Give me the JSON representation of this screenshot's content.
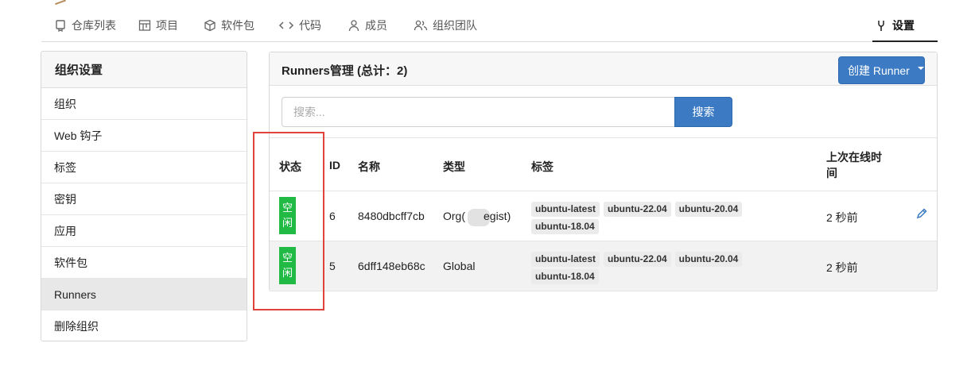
{
  "nav": {
    "items": [
      {
        "label": "仓库列表",
        "icon": "repo-list-icon"
      },
      {
        "label": "项目",
        "icon": "project-icon"
      },
      {
        "label": "软件包",
        "icon": "package-icon"
      },
      {
        "label": "代码",
        "icon": "code-icon"
      },
      {
        "label": "成员",
        "icon": "member-icon"
      },
      {
        "label": "组织团队",
        "icon": "team-icon"
      }
    ],
    "settings": {
      "label": "设置",
      "icon": "tool-icon"
    }
  },
  "sidebar": {
    "title": "组织设置",
    "items": [
      {
        "label": "组织"
      },
      {
        "label": "Web 钩子"
      },
      {
        "label": "标签"
      },
      {
        "label": "密钥"
      },
      {
        "label": "应用"
      },
      {
        "label": "软件包"
      },
      {
        "label": "Runners"
      },
      {
        "label": "删除组织"
      }
    ],
    "active": "Runners"
  },
  "panel": {
    "title": "Runners管理 (总计：2)",
    "create_button": "创建 Runner",
    "search": {
      "placeholder": "搜索...",
      "value": "",
      "button": "搜索"
    }
  },
  "table": {
    "headers": {
      "status": "状态",
      "id": "ID",
      "name": "名称",
      "type": "类型",
      "labels": "标签",
      "last_online": "上次在线时间"
    },
    "rows": [
      {
        "status": "空闲",
        "id": "6",
        "name": "8480dbcff7cb",
        "type": "Org(",
        "type_suffix": "egist)",
        "labels": [
          "ubuntu-latest",
          "ubuntu-22.04",
          "ubuntu-20.04",
          "ubuntu-18.04"
        ],
        "last_online": "2 秒前"
      },
      {
        "status": "空闲",
        "id": "5",
        "name": "6dff148eb68c",
        "type": "Global",
        "type_suffix": "",
        "labels": [
          "ubuntu-latest",
          "ubuntu-22.04",
          "ubuntu-20.04",
          "ubuntu-18.04"
        ],
        "last_online": "2 秒前"
      }
    ]
  },
  "colors": {
    "primary": "#3c7bc4",
    "status_idle": "#21ba45",
    "highlight_box": "#e0433c"
  }
}
